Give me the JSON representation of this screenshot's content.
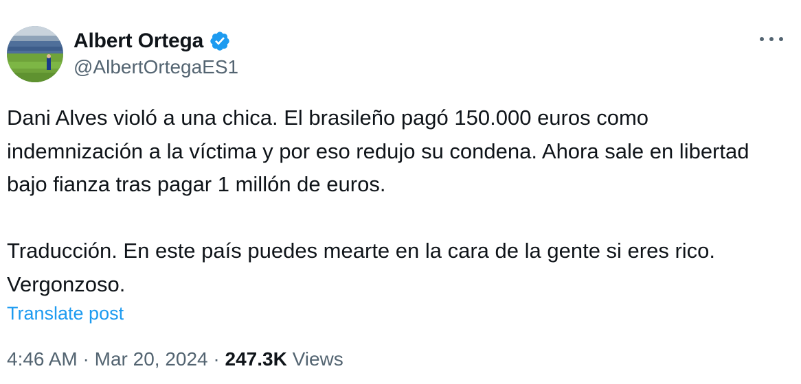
{
  "author": {
    "display_name": "Albert Ortega",
    "handle": "@AlbertOrtegaES1",
    "verified_icon": "verified-badge-icon",
    "avatar_icon": "stadium-avatar"
  },
  "post": {
    "paragraphs": [
      "Dani Alves violó a una chica. El brasileño pagó 150.000 euros como indemnización a la víctima y por eso redujo su condena. Ahora sale en libertad bajo fianza tras pagar 1 millón de euros.",
      "Traducción. En este país puedes mearte en la cara de la gente si eres rico. Vergonzoso."
    ],
    "translate_label": "Translate post"
  },
  "meta": {
    "time": "4:46 AM",
    "separator1": " · ",
    "date": "Mar 20, 2024",
    "separator2": " · ",
    "views_count": "247.3K",
    "views_label": " Views"
  },
  "colors": {
    "text": "#0f1419",
    "secondary": "#536471",
    "link": "#1d9bf0",
    "verified": "#1d9bf0"
  }
}
